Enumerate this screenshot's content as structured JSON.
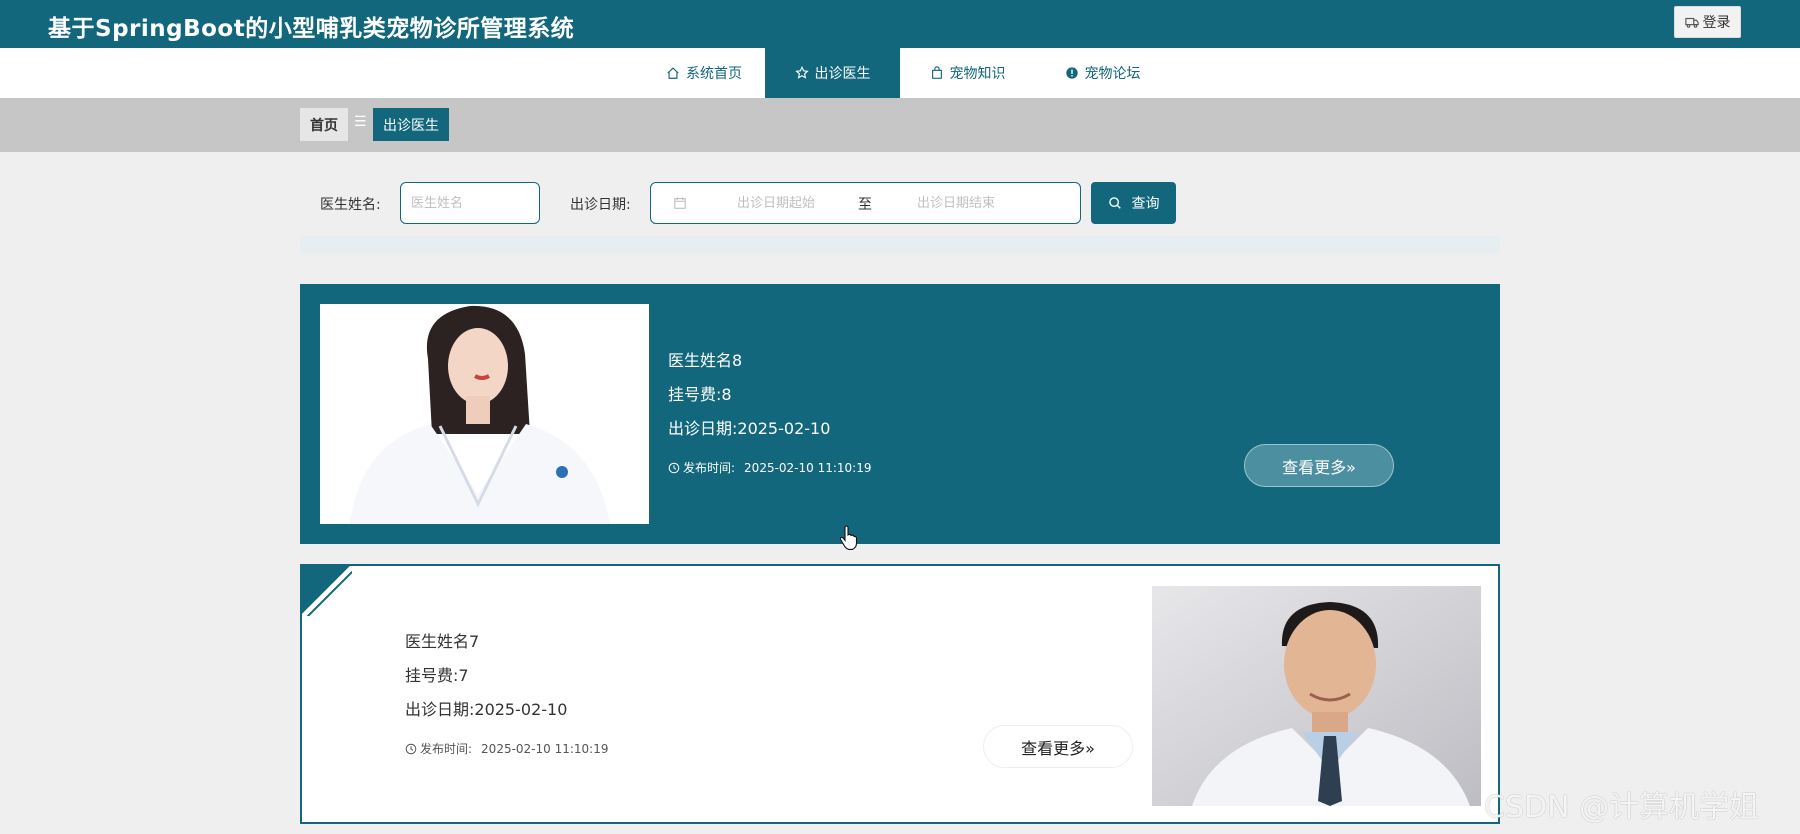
{
  "header": {
    "title": "基于SpringBoot的小型哺乳类宠物诊所管理系统",
    "login_label": "登录"
  },
  "nav": {
    "items": [
      {
        "label": "系统首页",
        "icon": "home-icon"
      },
      {
        "label": "出诊医生",
        "icon": "star-icon",
        "active": true
      },
      {
        "label": "宠物知识",
        "icon": "bag-icon"
      },
      {
        "label": "宠物论坛",
        "icon": "info-icon"
      }
    ]
  },
  "breadcrumb": {
    "home": "首页",
    "separator": "☰",
    "current": "出诊医生"
  },
  "search": {
    "name_label": "医生姓名:",
    "name_placeholder": "医生姓名",
    "date_label": "出诊日期:",
    "date_start_placeholder": "出诊日期起始",
    "date_to": "至",
    "date_end_placeholder": "出诊日期结束",
    "button_label": "查询"
  },
  "doctors": [
    {
      "name": "医生姓名8",
      "fee": "挂号费:8",
      "date": "出诊日期:2025-02-10",
      "publish_label": "发布时间:",
      "publish_time": "2025-02-10 11:10:19",
      "more_label": "查看更多»"
    },
    {
      "name": "医生姓名7",
      "fee": "挂号费:7",
      "date": "出诊日期:2025-02-10",
      "publish_label": "发布时间:",
      "publish_time": "2025-02-10 11:10:19",
      "more_label": "查看更多»"
    }
  ],
  "watermark": "CSDN @计算机学姐",
  "colors": {
    "primary": "#12677c",
    "page_bg": "#efefef",
    "crumb_bg": "#c6c6c6"
  }
}
